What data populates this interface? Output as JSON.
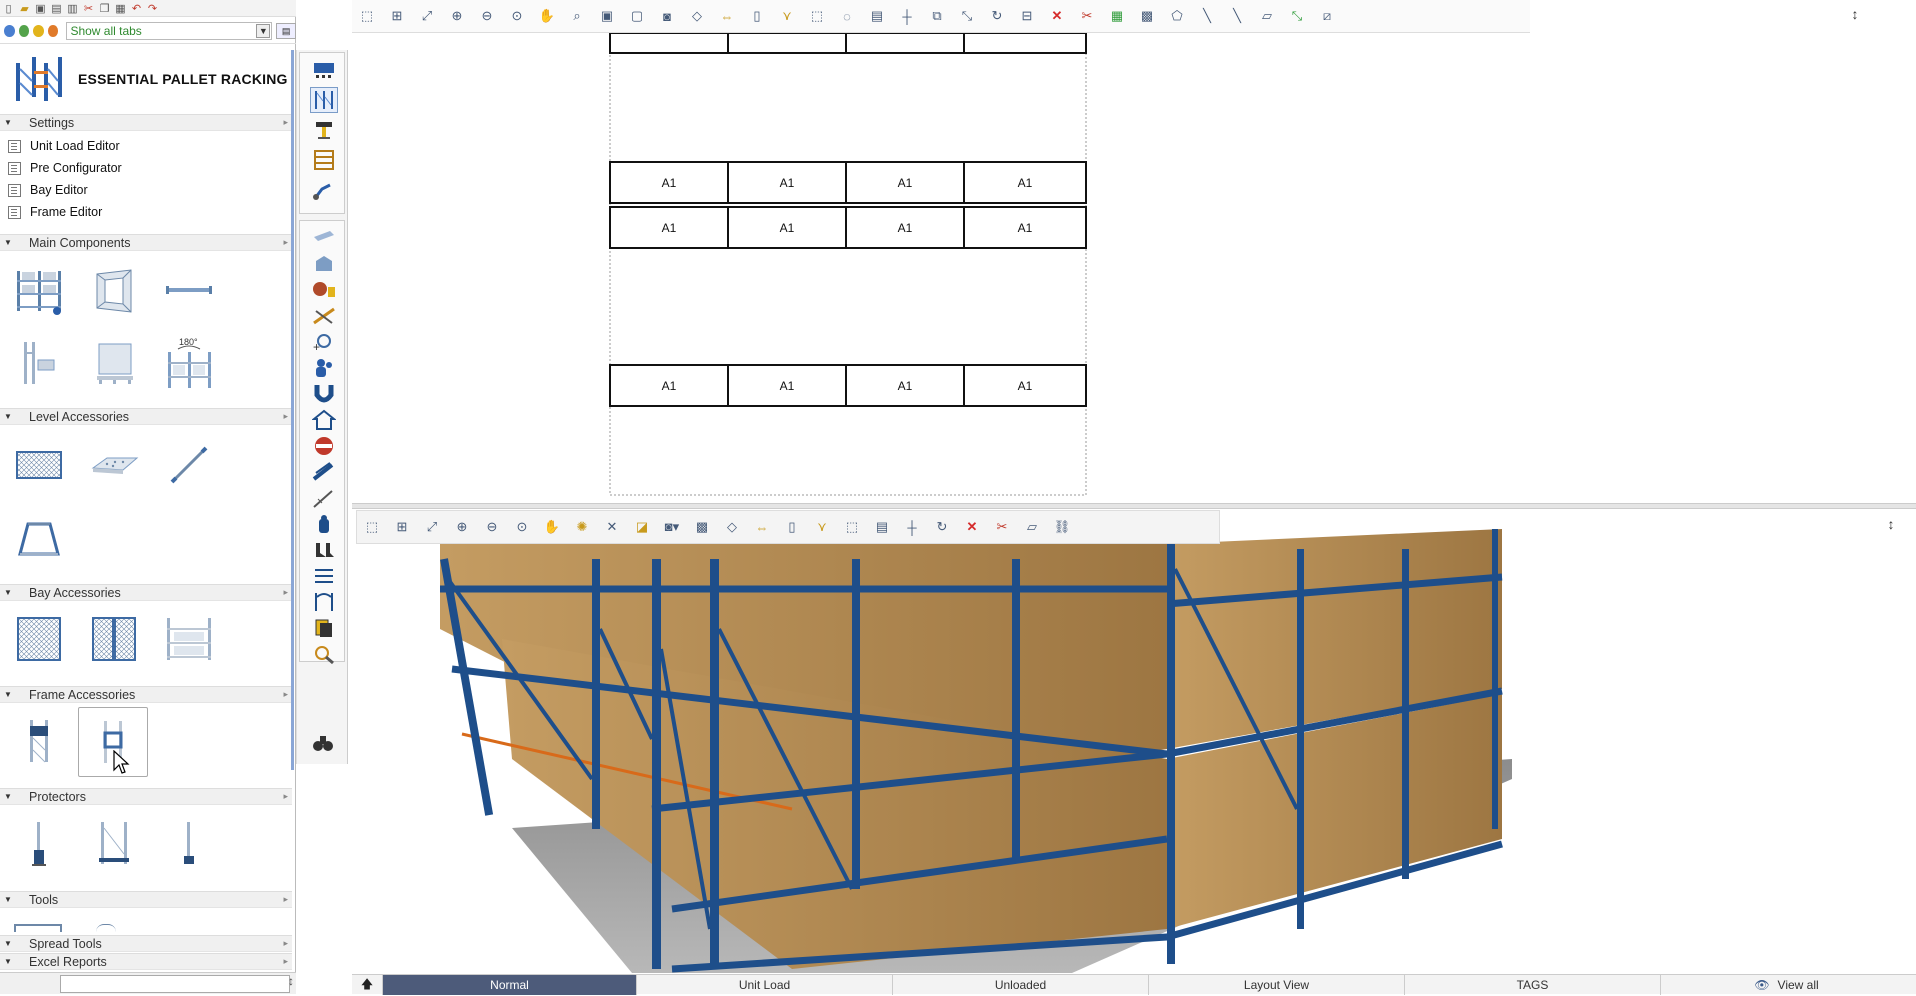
{
  "tabs_bar": {
    "selected": "Show all tabs"
  },
  "brand": {
    "title": "ESSENTIAL PALLET RACKING"
  },
  "sections": {
    "settings": "Settings",
    "main_components": "Main Components",
    "level_accessories": "Level Accessories",
    "bay_accessories": "Bay Accessories",
    "frame_accessories": "Frame Accessories",
    "protectors": "Protectors",
    "tools": "Tools",
    "spread_tools": "Spread Tools",
    "excel_reports": "Excel Reports"
  },
  "settings_items": [
    "Unit Load Editor",
    "Pre Configurator",
    "Bay Editor",
    "Frame Editor"
  ],
  "plan": {
    "cell_label": "A1",
    "rows": [
      [
        "A1",
        "A1",
        "A1",
        "A1"
      ],
      [
        "A1",
        "A1",
        "A1",
        "A1"
      ],
      [
        "A1",
        "A1",
        "A1",
        "A1"
      ]
    ]
  },
  "main_components_extra": {
    "rotate_label": "180°"
  },
  "status_bar": {
    "segments": [
      "Normal",
      "Unit Load",
      "Unloaded",
      "Layout View",
      "TAGS"
    ],
    "active": "Normal",
    "view_all": "View all"
  },
  "colors": {
    "rack_blue": "#1e4e8a",
    "beam_orange": "#d86a1a",
    "box_brown": "#b58c55",
    "floor_gray": "#9a9a9a",
    "accent_green": "#2f8a2f",
    "status_active": "#4d5b7a"
  },
  "icons": {
    "toolbar_top": [
      "select",
      "select-area",
      "zoom-extents",
      "zoom-in",
      "zoom-out",
      "zoom-window",
      "pan",
      "zoom-selection",
      "fit",
      "frame",
      "camera",
      "eraser",
      "move",
      "copy",
      "filter",
      "lasso",
      "lasso-alt",
      "comment",
      "measure",
      "connect",
      "scale",
      "rotate",
      "align",
      "delete",
      "cut-to",
      "group",
      "ungroup",
      "shape",
      "line",
      "line-alt",
      "ruler",
      "arrow",
      "ruler-alt"
    ],
    "toolbar_3d": [
      "select",
      "select-area",
      "zoom-extents",
      "zoom-in",
      "zoom-out",
      "zoom-window",
      "pan",
      "orbit",
      "expand",
      "walk",
      "camera",
      "render",
      "eraser",
      "move",
      "copy",
      "filter",
      "lasso",
      "comment",
      "measure",
      "rotate",
      "delete",
      "cut-to",
      "ruler",
      "link"
    ]
  }
}
